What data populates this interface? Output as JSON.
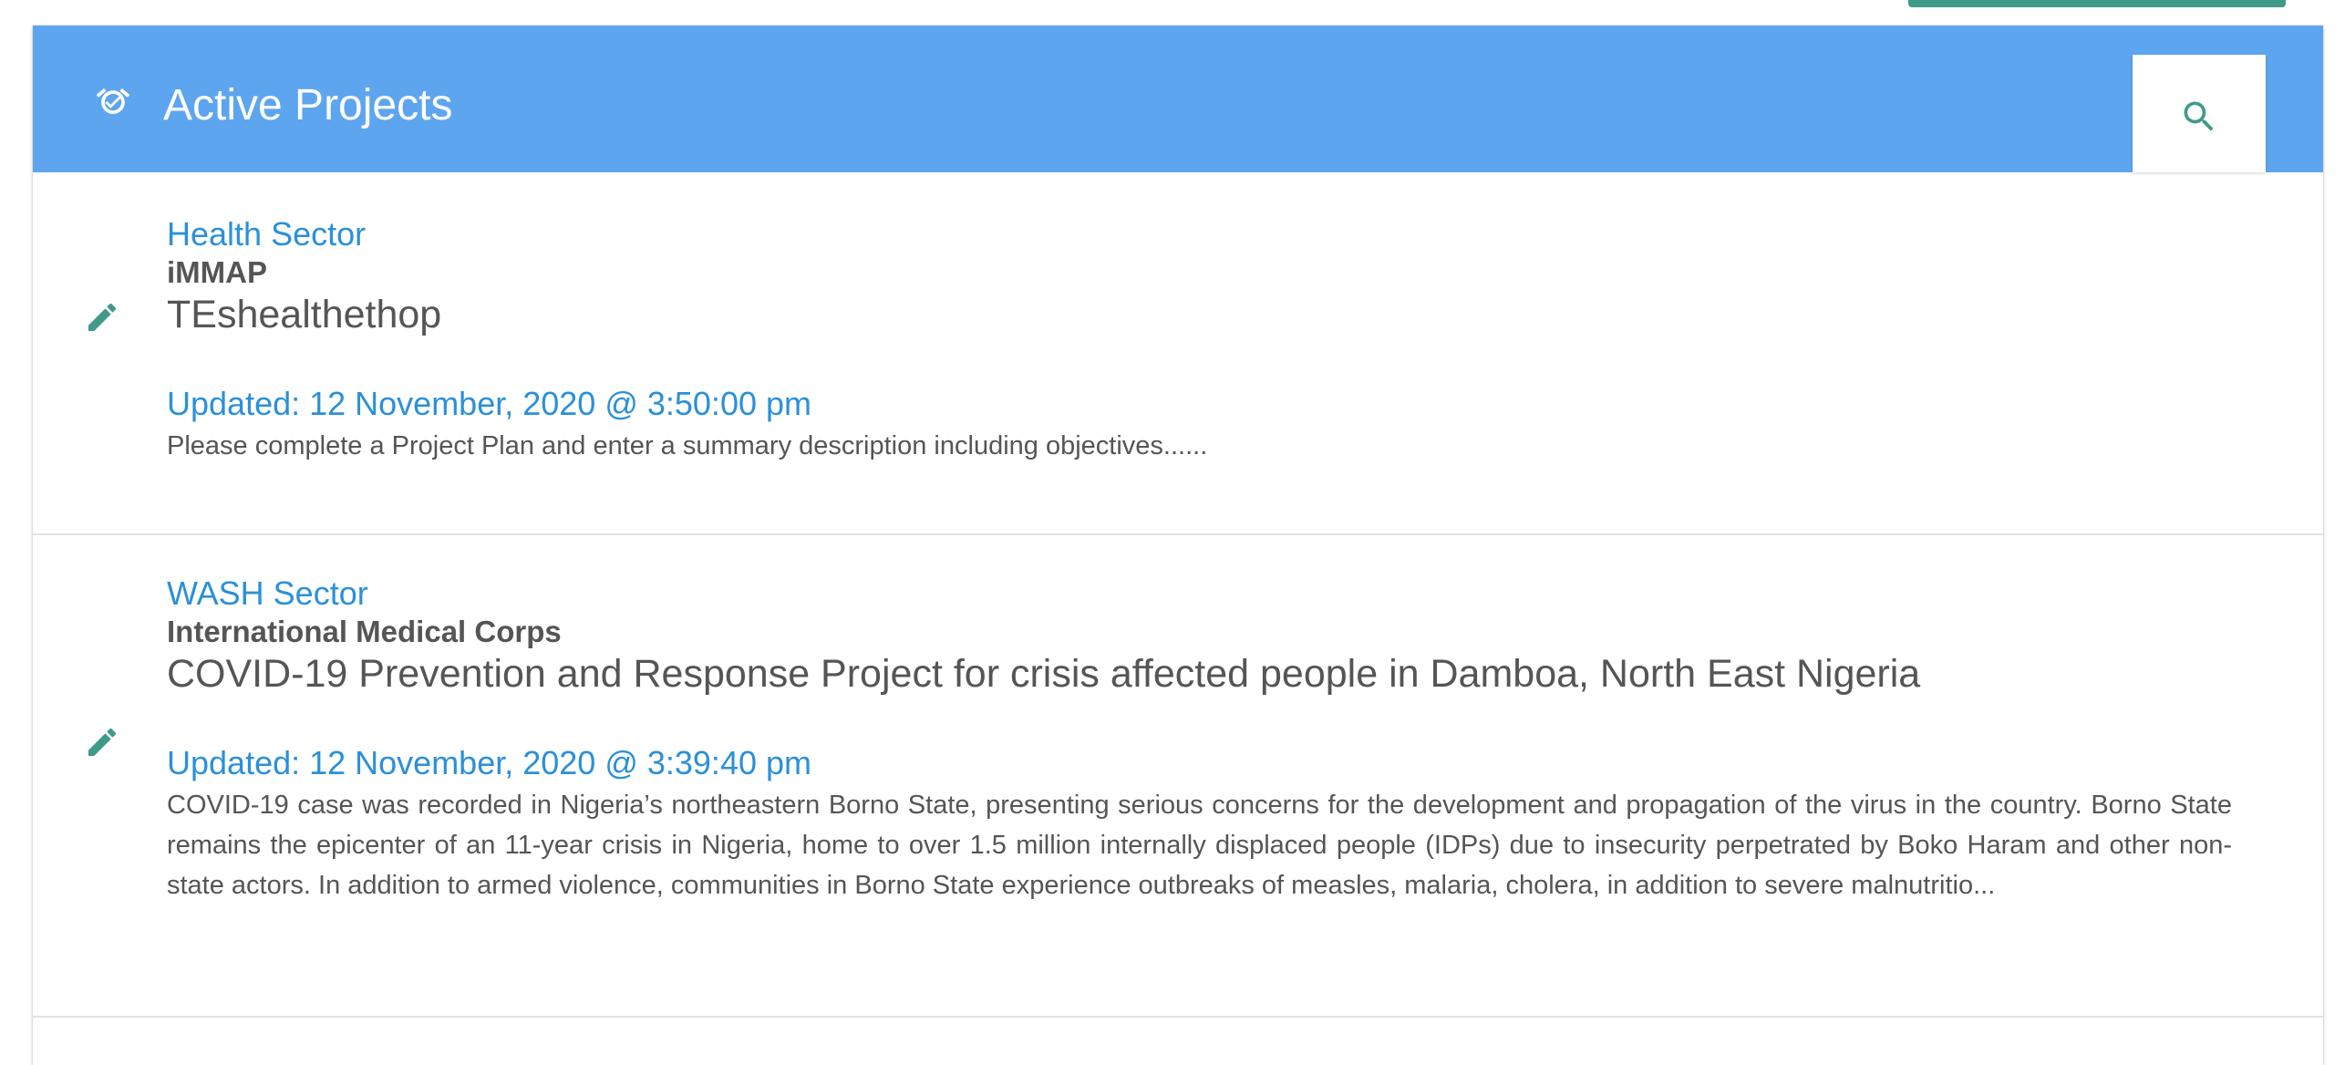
{
  "panel": {
    "title": "Active Projects",
    "header_color": "#5ea5ef",
    "header_icon": "alarm-check-icon",
    "search_icon": "search-icon"
  },
  "projects": [
    {
      "sector": "Health Sector",
      "organization": "iMMAP",
      "title": "TEshealthethop",
      "updated": "Updated: 12 November, 2020 @ 3:50:00 pm",
      "description": "Please complete a Project Plan and enter a summary description including objectives......",
      "edit_icon": "pencil-icon"
    },
    {
      "sector": "WASH Sector",
      "organization": "International Medical Corps",
      "title": "COVID-19 Prevention and Response Project for crisis affected people in Damboa, North East Nigeria",
      "updated": "Updated: 12 November, 2020 @ 3:39:40 pm",
      "description": "COVID-19 case was recorded in Nigeria’s northeastern Borno State, presenting serious concerns for the development and propagation of the virus in the country. Borno State remains the epicenter of an 11-year crisis in Nigeria, home to over 1.5 million internally displaced people (IDPs) due to insecurity perpetrated by Boko Haram and other non-state actors. In addition to armed violence, communities in Borno State experience outbreaks of measles, malaria, cholera, in addition to severe malnutritio...",
      "edit_icon": "pencil-icon"
    }
  ],
  "colors": {
    "accent_link": "#2b90d9",
    "icon_teal": "#3f9a8a",
    "text_gray": "#555555"
  }
}
